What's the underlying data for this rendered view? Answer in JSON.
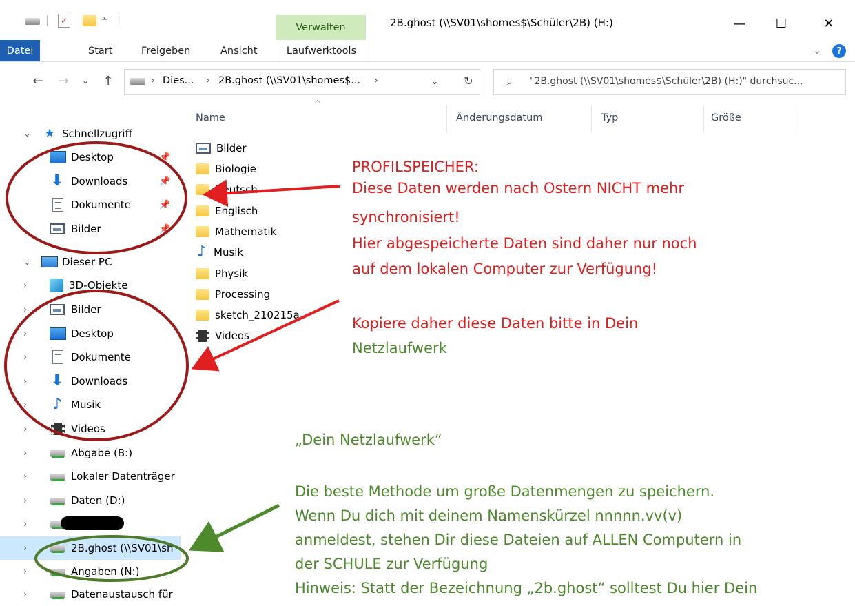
{
  "titlebar": {
    "context_tab": "Verwalten",
    "window_title": "2B.ghost (\\\\SV01\\shomes$\\Schüler\\2B) (H:)",
    "minimize": "—",
    "maximize": "☐",
    "close": "✕"
  },
  "ribbon": {
    "tabs": [
      "Datei",
      "Start",
      "Freigeben",
      "Ansicht",
      "Laufwerktools"
    ],
    "expand": "⌄",
    "help": "?"
  },
  "address": {
    "crumbs": [
      "Dies...",
      "2B.ghost (\\\\SV01\\shomes$..."
    ],
    "separator": "›",
    "search_placeholder": "\"2B.ghost (\\\\SV01\\shomes$\\Schüler\\2B) (H:)\" durchsuc..."
  },
  "navpane": {
    "items": [
      {
        "label": "Schnellzugriff",
        "icon": "star-icon"
      },
      {
        "label": "Desktop",
        "icon": "desktop-icon"
      },
      {
        "label": "Downloads",
        "icon": "download-icon"
      },
      {
        "label": "Dokumente",
        "icon": "document-icon"
      },
      {
        "label": "Bilder",
        "icon": "pictures-icon"
      },
      {
        "label": "Dieser PC",
        "icon": "pc-icon"
      },
      {
        "label": "3D-Objekte",
        "icon": "cube-icon"
      },
      {
        "label": "Bilder",
        "icon": "pictures-icon"
      },
      {
        "label": "Desktop",
        "icon": "desktop-icon"
      },
      {
        "label": "Dokumente",
        "icon": "document-icon"
      },
      {
        "label": "Downloads",
        "icon": "download-icon"
      },
      {
        "label": "Musik",
        "icon": "music-icon"
      },
      {
        "label": "Videos",
        "icon": "video-icon"
      },
      {
        "label": "Abgabe (B:)",
        "icon": "network-drive-icon"
      },
      {
        "label": "Lokaler Datenträger",
        "icon": "local-drive-icon"
      },
      {
        "label": "Daten (D:)",
        "icon": "drive-icon"
      },
      {
        "label": "",
        "icon": "network-drive-icon"
      },
      {
        "label": "2B.ghost (\\\\SV01\\sh",
        "icon": "network-drive-icon"
      },
      {
        "label": "Angaben (N:)",
        "icon": "network-drive-icon"
      },
      {
        "label": "Datenaustausch für",
        "icon": "network-drive-icon"
      }
    ]
  },
  "columns": [
    "Name",
    "Änderungsdatum",
    "Typ",
    "Größe"
  ],
  "files": [
    {
      "name": "Bilder",
      "icon": "pictures-icon"
    },
    {
      "name": "Biologie",
      "icon": "folder-icon"
    },
    {
      "name": "Deutsch",
      "icon": "folder-icon"
    },
    {
      "name": "Englisch",
      "icon": "folder-icon"
    },
    {
      "name": "Mathematik",
      "icon": "folder-icon"
    },
    {
      "name": "Musik",
      "icon": "music-icon"
    },
    {
      "name": "Physik",
      "icon": "folder-icon"
    },
    {
      "name": "Processing",
      "icon": "folder-icon"
    },
    {
      "name": "sketch_210215a",
      "icon": "folder-icon"
    },
    {
      "name": "Videos",
      "icon": "video-icon"
    }
  ],
  "annotations": {
    "profile": [
      "PROFILSPEICHER:",
      "Diese Daten werden nach Ostern NICHT mehr",
      "synchronisiert!",
      "Hier abgespeicherte Daten sind daher nur noch",
      "auf dem lokalen Computer zur Verfügung!"
    ],
    "copy_line1": "Kopiere daher diese Daten bitte in Dein",
    "copy_line2": "Netzlaufwerk",
    "network_title": "„Dein Netzlaufwerk“",
    "network": [
      "Die beste Methode um große Datenmengen zu speichern.",
      "Wenn Du dich mit deinem Namenskürzel nnnnn.vv(v)",
      "anmeldest, stehen Dir diese Dateien auf ALLEN Computern in",
      "der SCHULE zur Verfügung",
      "Hinweis: Statt der Bezeichnung „2b.ghost“ solltest Du hier Dein"
    ],
    "colors": {
      "red": "#e02020",
      "green": "#4c8a2c",
      "circle_red": "#9b1b1b",
      "circle_green": "#4d7a2b"
    }
  }
}
